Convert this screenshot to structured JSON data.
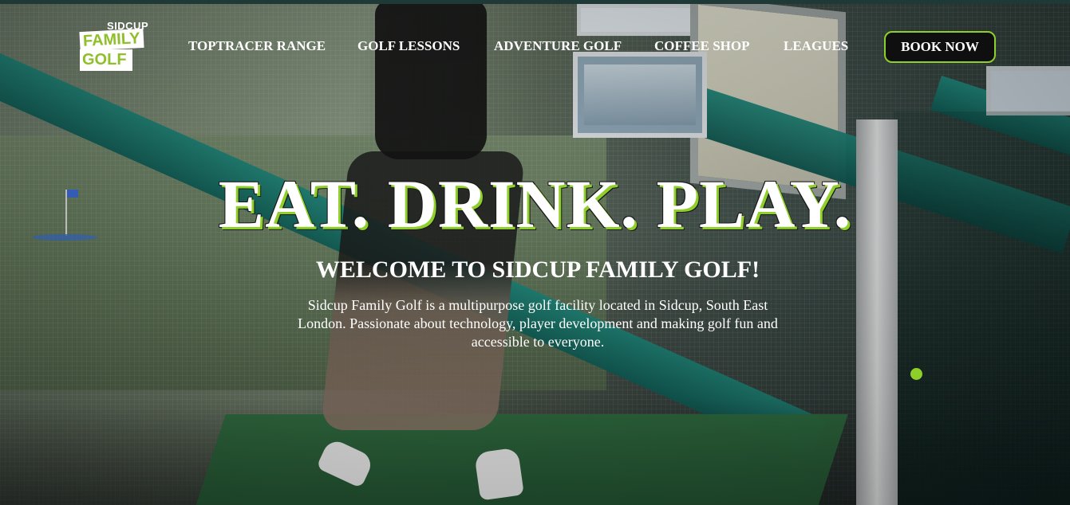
{
  "brand": {
    "logo_top": "SIDCUP",
    "logo_middle": "FAMILY",
    "logo_bottom": "GOLF",
    "accent_color": "#8fcf2a"
  },
  "nav": {
    "items": [
      {
        "label": "TOPTRACER RANGE"
      },
      {
        "label": "GOLF LESSONS"
      },
      {
        "label": "ADVENTURE GOLF"
      },
      {
        "label": "COFFEE SHOP"
      },
      {
        "label": "LEAGUES"
      }
    ],
    "cta_label": "BOOK NOW"
  },
  "hero": {
    "headline": "EAT. DRINK. PLAY.",
    "subheading": "WELCOME TO SIDCUP FAMILY GOLF!",
    "description": "Sidcup Family Golf is a multipurpose golf facility located in Sidcup, South East London. Passionate about technology, player development and making golf fun and accessible to everyone."
  }
}
